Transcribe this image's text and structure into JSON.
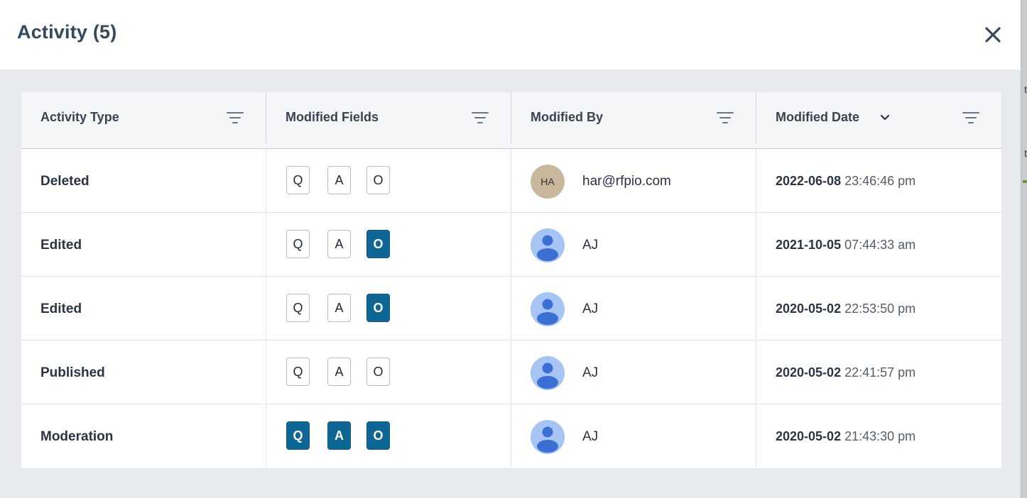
{
  "modal": {
    "title": "Activity (5)",
    "close_icon": "close-icon"
  },
  "table": {
    "columns": [
      {
        "label": "Activity Type",
        "icon": "filter-icon"
      },
      {
        "label": "Modified Fields",
        "icon": "filter-icon"
      },
      {
        "label": "Modified By",
        "icon": "filter-icon"
      },
      {
        "label": "Modified Date",
        "icon": "filter-icon",
        "sort_icon": "chevron-down-icon"
      }
    ],
    "rows": [
      {
        "activity": "Deleted",
        "fields": [
          {
            "label": "Q",
            "active": false
          },
          {
            "label": "A",
            "active": false
          },
          {
            "label": "O",
            "active": false
          }
        ],
        "avatar_initials": "HA",
        "avatar_type": "initials",
        "user": "har@rfpio.com",
        "date": "2022-06-08",
        "time": "23:46:46 pm"
      },
      {
        "activity": "Edited",
        "fields": [
          {
            "label": "Q",
            "active": false
          },
          {
            "label": "A",
            "active": false
          },
          {
            "label": "O",
            "active": true
          }
        ],
        "avatar_type": "person",
        "user": "AJ",
        "date": "2021-10-05",
        "time": "07:44:33 am"
      },
      {
        "activity": "Edited",
        "fields": [
          {
            "label": "Q",
            "active": false
          },
          {
            "label": "A",
            "active": false
          },
          {
            "label": "O",
            "active": true
          }
        ],
        "avatar_type": "person",
        "user": "AJ",
        "date": "2020-05-02",
        "time": "22:53:50 pm"
      },
      {
        "activity": "Published",
        "fields": [
          {
            "label": "Q",
            "active": false
          },
          {
            "label": "A",
            "active": false
          },
          {
            "label": "O",
            "active": false
          }
        ],
        "avatar_type": "person",
        "user": "AJ",
        "date": "2020-05-02",
        "time": "22:41:57 pm"
      },
      {
        "activity": "Moderation",
        "fields": [
          {
            "label": "Q",
            "active": true
          },
          {
            "label": "A",
            "active": true
          },
          {
            "label": "O",
            "active": true
          }
        ],
        "avatar_type": "person",
        "user": "AJ",
        "date": "2020-05-02",
        "time": "21:43:30 pm"
      }
    ]
  },
  "colors": {
    "active_chip": "#0e6694",
    "title": "#34495e",
    "person_avatar_bg": "#a6c5f5",
    "person_avatar_fg": "#3b6fd4",
    "initials_avatar_bg": "#c9b89c"
  },
  "background": {
    "edge_glyph_1": "t",
    "edge_glyph_2": "t"
  }
}
